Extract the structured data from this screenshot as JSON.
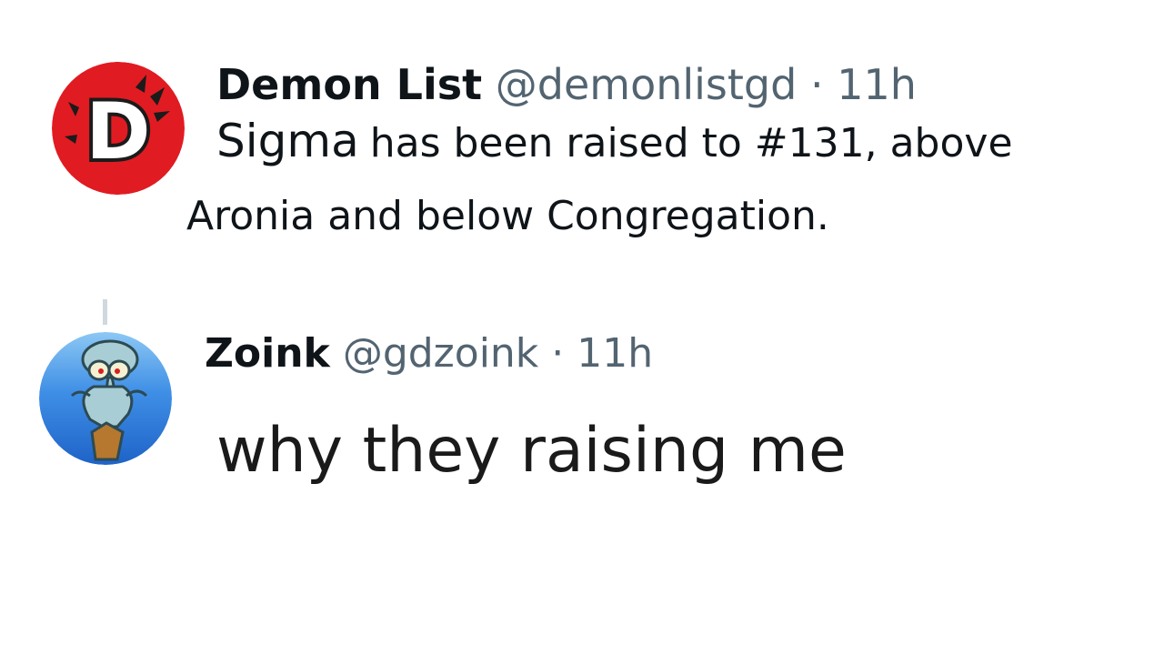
{
  "tweets": [
    {
      "display_name": "Demon List",
      "handle": "@demonlistgd",
      "separator": "·",
      "time": "11h",
      "text_part1": "Sigma",
      "text_part2": "has been raised to #131, above",
      "text_part3": "Aronia and below Congregation.",
      "avatar_icon": "demon-list-logo-icon"
    },
    {
      "display_name": "Zoink",
      "handle": "@gdzoink",
      "separator": "·",
      "time": "11h",
      "text": "why they raising me",
      "avatar_icon": "squidward-avatar-icon"
    }
  ],
  "colors": {
    "name": "#0f1419",
    "handle": "#536471",
    "demon_avatar_red": "#e11b22",
    "zoink_avatar_blue": "#3f8fe6",
    "thread_line": "#cfd9de"
  }
}
